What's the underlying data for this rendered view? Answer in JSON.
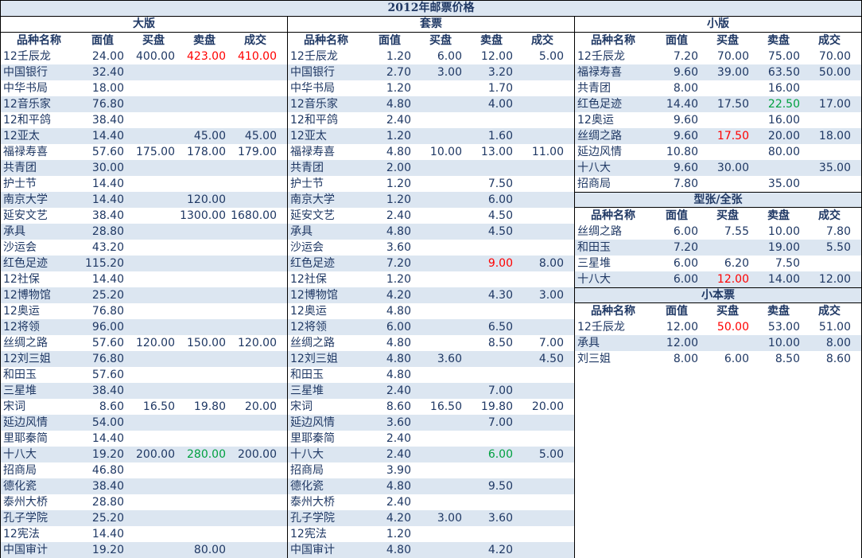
{
  "title": "2012年邮票价格",
  "columns": [
    "品种名称",
    "面值",
    "买盘",
    "卖盘",
    "成交"
  ],
  "colors": {
    "header_fill": "#dce6f1",
    "text": "#1f3864",
    "highlight_red": "#ff0000",
    "highlight_green": "#00a040"
  },
  "sections": [
    {
      "title": "大版",
      "rows": [
        {
          "name": "12壬辰龙",
          "face": "24.00",
          "bid": "400.00",
          "ask": "423.00",
          "deal": "410.00",
          "ask_color": "red",
          "deal_color": "red"
        },
        {
          "name": "中国银行",
          "face": "32.40",
          "bid": "",
          "ask": "",
          "deal": ""
        },
        {
          "name": "中华书局",
          "face": "18.00",
          "bid": "",
          "ask": "",
          "deal": ""
        },
        {
          "name": "12音乐家",
          "face": "76.80",
          "bid": "",
          "ask": "",
          "deal": ""
        },
        {
          "name": "12和平鸽",
          "face": "38.40",
          "bid": "",
          "ask": "",
          "deal": ""
        },
        {
          "name": "12亚太",
          "face": "14.40",
          "bid": "",
          "ask": "45.00",
          "deal": "45.00"
        },
        {
          "name": "福禄寿喜",
          "face": "57.60",
          "bid": "175.00",
          "ask": "178.00",
          "deal": "179.00"
        },
        {
          "name": "共青团",
          "face": "30.00",
          "bid": "",
          "ask": "",
          "deal": ""
        },
        {
          "name": "护士节",
          "face": "14.40",
          "bid": "",
          "ask": "",
          "deal": ""
        },
        {
          "name": "南京大学",
          "face": "14.40",
          "bid": "",
          "ask": "120.00",
          "deal": ""
        },
        {
          "name": "延安文艺",
          "face": "38.40",
          "bid": "",
          "ask": "1300.00",
          "deal": "1680.00"
        },
        {
          "name": "承具",
          "face": "28.80",
          "bid": "",
          "ask": "",
          "deal": ""
        },
        {
          "name": "沙运会",
          "face": "43.20",
          "bid": "",
          "ask": "",
          "deal": ""
        },
        {
          "name": "红色足迹",
          "face": "115.20",
          "bid": "",
          "ask": "",
          "deal": ""
        },
        {
          "name": "12社保",
          "face": "14.40",
          "bid": "",
          "ask": "",
          "deal": ""
        },
        {
          "name": "12博物馆",
          "face": "25.20",
          "bid": "",
          "ask": "",
          "deal": ""
        },
        {
          "name": "12奥运",
          "face": "76.80",
          "bid": "",
          "ask": "",
          "deal": ""
        },
        {
          "name": "12将领",
          "face": "96.00",
          "bid": "",
          "ask": "",
          "deal": ""
        },
        {
          "name": "丝绸之路",
          "face": "57.60",
          "bid": "120.00",
          "ask": "150.00",
          "deal": "120.00"
        },
        {
          "name": "12刘三姐",
          "face": "76.80",
          "bid": "",
          "ask": "",
          "deal": ""
        },
        {
          "name": "和田玉",
          "face": "57.60",
          "bid": "",
          "ask": "",
          "deal": ""
        },
        {
          "name": "三星堆",
          "face": "38.40",
          "bid": "",
          "ask": "",
          "deal": ""
        },
        {
          "name": "宋词",
          "face": "8.60",
          "bid": "16.50",
          "ask": "19.80",
          "deal": "20.00"
        },
        {
          "name": "延边风情",
          "face": "54.00",
          "bid": "",
          "ask": "",
          "deal": ""
        },
        {
          "name": "里耶秦简",
          "face": "14.40",
          "bid": "",
          "ask": "",
          "deal": ""
        },
        {
          "name": "十八大",
          "face": "19.20",
          "bid": "200.00",
          "ask": "280.00",
          "deal": "200.00",
          "ask_color": "green"
        },
        {
          "name": "招商局",
          "face": "46.80",
          "bid": "",
          "ask": "",
          "deal": ""
        },
        {
          "name": "德化瓷",
          "face": "38.40",
          "bid": "",
          "ask": "",
          "deal": ""
        },
        {
          "name": "泰州大桥",
          "face": "28.80",
          "bid": "",
          "ask": "",
          "deal": ""
        },
        {
          "name": "孔子学院",
          "face": "25.20",
          "bid": "",
          "ask": "",
          "deal": ""
        },
        {
          "name": "12宪法",
          "face": "14.40",
          "bid": "",
          "ask": "",
          "deal": ""
        },
        {
          "name": "中国审计",
          "face": "19.20",
          "bid": "",
          "ask": "80.00",
          "deal": ""
        }
      ]
    },
    {
      "title": "套票",
      "rows": [
        {
          "name": "12壬辰龙",
          "face": "1.20",
          "bid": "6.00",
          "ask": "12.00",
          "deal": "5.00"
        },
        {
          "name": "中国银行",
          "face": "2.70",
          "bid": "3.00",
          "ask": "3.20",
          "deal": ""
        },
        {
          "name": "中华书局",
          "face": "1.20",
          "bid": "",
          "ask": "1.70",
          "deal": ""
        },
        {
          "name": "12音乐家",
          "face": "4.80",
          "bid": "",
          "ask": "4.00",
          "deal": ""
        },
        {
          "name": "12和平鸽",
          "face": "2.40",
          "bid": "",
          "ask": "",
          "deal": ""
        },
        {
          "name": "12亚太",
          "face": "1.20",
          "bid": "",
          "ask": "1.60",
          "deal": ""
        },
        {
          "name": "福禄寿喜",
          "face": "4.80",
          "bid": "10.00",
          "ask": "13.00",
          "deal": "11.00"
        },
        {
          "name": "共青团",
          "face": "2.00",
          "bid": "",
          "ask": "",
          "deal": ""
        },
        {
          "name": "护士节",
          "face": "1.20",
          "bid": "",
          "ask": "7.50",
          "deal": ""
        },
        {
          "name": "南京大学",
          "face": "1.20",
          "bid": "",
          "ask": "6.00",
          "deal": ""
        },
        {
          "name": "延安文艺",
          "face": "2.40",
          "bid": "",
          "ask": "4.50",
          "deal": ""
        },
        {
          "name": "承具",
          "face": "4.80",
          "bid": "",
          "ask": "4.50",
          "deal": ""
        },
        {
          "name": "沙运会",
          "face": "3.60",
          "bid": "",
          "ask": "",
          "deal": ""
        },
        {
          "name": "红色足迹",
          "face": "7.20",
          "bid": "",
          "ask": "9.00",
          "deal": "8.00",
          "ask_color": "red"
        },
        {
          "name": "12社保",
          "face": "1.20",
          "bid": "",
          "ask": "",
          "deal": ""
        },
        {
          "name": "12博物馆",
          "face": "4.20",
          "bid": "",
          "ask": "4.30",
          "deal": "3.00"
        },
        {
          "name": "12奥运",
          "face": "4.80",
          "bid": "",
          "ask": "",
          "deal": ""
        },
        {
          "name": "12将领",
          "face": "6.00",
          "bid": "",
          "ask": "6.50",
          "deal": ""
        },
        {
          "name": "丝绸之路",
          "face": "4.80",
          "bid": "",
          "ask": "8.50",
          "deal": "7.00"
        },
        {
          "name": "12刘三姐",
          "face": "4.80",
          "bid": "3.60",
          "ask": "",
          "deal": "4.50"
        },
        {
          "name": "和田玉",
          "face": "4.80",
          "bid": "",
          "ask": "",
          "deal": ""
        },
        {
          "name": "三星堆",
          "face": "2.40",
          "bid": "",
          "ask": "7.00",
          "deal": ""
        },
        {
          "name": "宋词",
          "face": "8.60",
          "bid": "16.50",
          "ask": "19.80",
          "deal": "20.00"
        },
        {
          "name": "延边风情",
          "face": "3.60",
          "bid": "",
          "ask": "7.00",
          "deal": ""
        },
        {
          "name": "里耶秦简",
          "face": "2.40",
          "bid": "",
          "ask": "",
          "deal": ""
        },
        {
          "name": "十八大",
          "face": "2.40",
          "bid": "",
          "ask": "6.00",
          "deal": "5.00",
          "ask_color": "green"
        },
        {
          "name": "招商局",
          "face": "3.90",
          "bid": "",
          "ask": "",
          "deal": ""
        },
        {
          "name": "德化瓷",
          "face": "4.80",
          "bid": "",
          "ask": "9.50",
          "deal": ""
        },
        {
          "name": "泰州大桥",
          "face": "2.40",
          "bid": "",
          "ask": "",
          "deal": ""
        },
        {
          "name": "孔子学院",
          "face": "4.20",
          "bid": "3.00",
          "ask": "3.60",
          "deal": ""
        },
        {
          "name": "12宪法",
          "face": "1.20",
          "bid": "",
          "ask": "",
          "deal": ""
        },
        {
          "name": "中国审计",
          "face": "4.80",
          "bid": "",
          "ask": "4.20",
          "deal": ""
        }
      ]
    },
    {
      "title": "小版",
      "rows": [
        {
          "name": "12壬辰龙",
          "face": "7.20",
          "bid": "70.00",
          "ask": "75.00",
          "deal": "70.00"
        },
        {
          "name": "福禄寿喜",
          "face": "9.60",
          "bid": "39.00",
          "ask": "63.50",
          "deal": "50.00"
        },
        {
          "name": "共青团",
          "face": "8.00",
          "bid": "",
          "ask": "16.00",
          "deal": ""
        },
        {
          "name": "红色足迹",
          "face": "14.40",
          "bid": "17.50",
          "ask": "22.50",
          "deal": "17.00",
          "ask_color": "green"
        },
        {
          "name": "12奥运",
          "face": "9.60",
          "bid": "",
          "ask": "16.00",
          "deal": ""
        },
        {
          "name": "丝绸之路",
          "face": "9.60",
          "bid": "17.50",
          "ask": "20.00",
          "deal": "18.00",
          "bid_color": "red"
        },
        {
          "name": "延边风情",
          "face": "10.80",
          "bid": "",
          "ask": "80.00",
          "deal": ""
        },
        {
          "name": "十八大",
          "face": "9.60",
          "bid": "30.00",
          "ask": "",
          "deal": "35.00"
        },
        {
          "name": "招商局",
          "face": "7.80",
          "bid": "",
          "ask": "35.00",
          "deal": ""
        }
      ]
    },
    {
      "title": "型张/全张",
      "rows": [
        {
          "name": "丝绸之路",
          "face": "6.00",
          "bid": "7.55",
          "ask": "10.00",
          "deal": "7.80"
        },
        {
          "name": "和田玉",
          "face": "7.20",
          "bid": "",
          "ask": "19.00",
          "deal": "5.50"
        },
        {
          "name": "三星堆",
          "face": "6.00",
          "bid": "6.20",
          "ask": "7.50",
          "deal": ""
        },
        {
          "name": "十八大",
          "face": "6.00",
          "bid": "12.00",
          "ask": "14.00",
          "deal": "12.00",
          "bid_color": "red"
        }
      ]
    },
    {
      "title": "小本票",
      "rows": [
        {
          "name": "12壬辰龙",
          "face": "12.00",
          "bid": "50.00",
          "ask": "53.00",
          "deal": "51.00",
          "bid_color": "red"
        },
        {
          "name": "承具",
          "face": "12.00",
          "bid": "",
          "ask": "10.00",
          "deal": "8.00"
        },
        {
          "name": "刘三姐",
          "face": "8.00",
          "bid": "6.00",
          "ask": "8.50",
          "deal": "8.60"
        }
      ]
    }
  ]
}
